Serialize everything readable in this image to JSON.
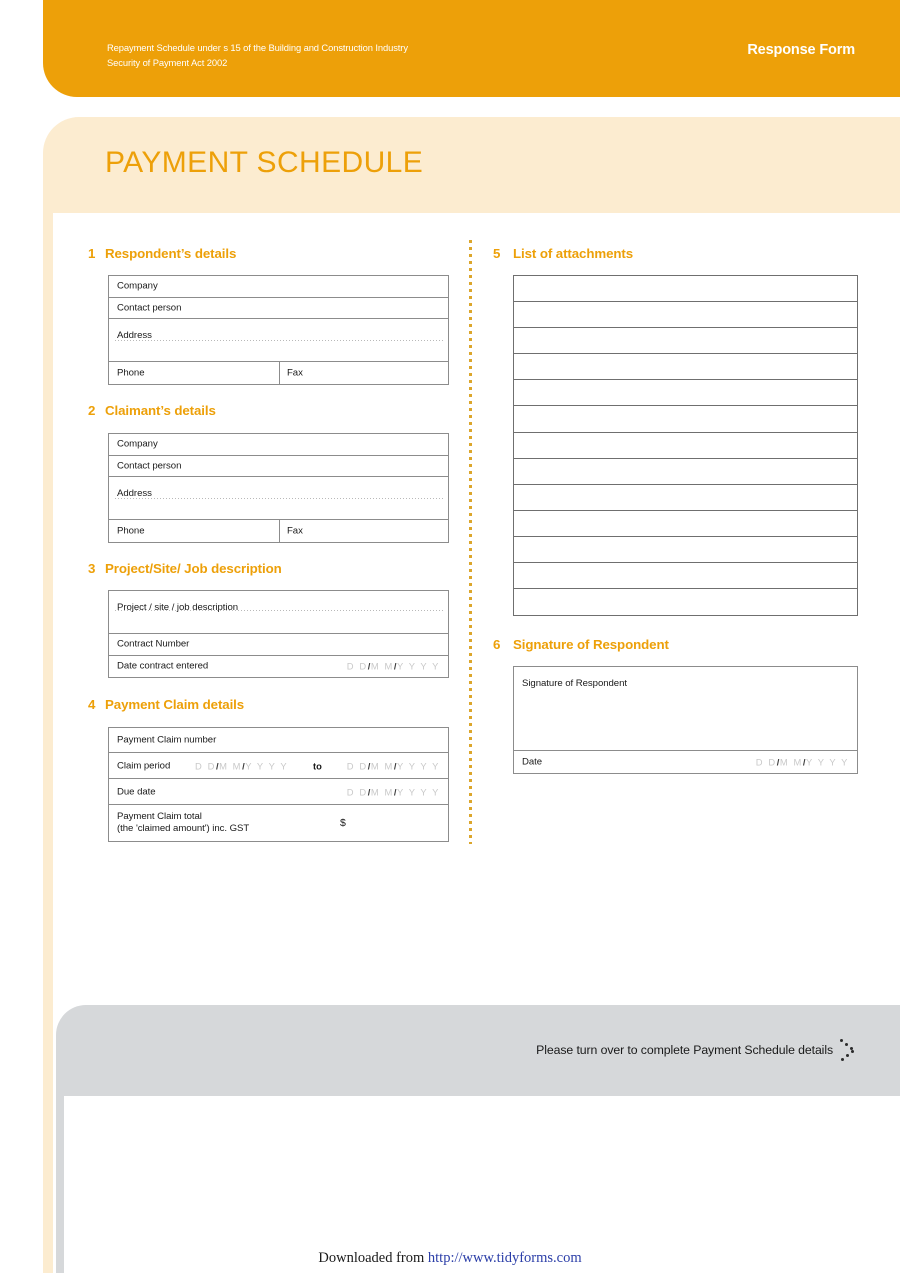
{
  "header": {
    "legal_line1": "Repayment Schedule under s 15 of the Building and Construction Industry",
    "legal_line2": "Security of Payment  Act 2002",
    "form_type": "Response Form",
    "brand_orange": "#eda009",
    "brand_cream": "#fcecd0",
    "brand_grey": "#d6d8da"
  },
  "title": "PAYMENT SCHEDULE",
  "sections": {
    "s1": {
      "number": "1",
      "heading": "Respondent’s details",
      "rows": {
        "company": "Company",
        "contact": "Contact person",
        "address": "Address",
        "phone": "Phone",
        "fax": "Fax"
      }
    },
    "s2": {
      "number": "2",
      "heading": "Claimant’s details",
      "rows": {
        "company": "Company",
        "contact": "Contact person",
        "address": "Address",
        "phone": "Phone",
        "fax": "Fax"
      }
    },
    "s3": {
      "number": "3",
      "heading": "Project/Site/ Job description",
      "rows": {
        "description": "Project / site / job description",
        "contract_number": "Contract Number",
        "date_entered": "Date contract entered"
      }
    },
    "s4": {
      "number": "4",
      "heading": "Payment Claim details",
      "rows": {
        "claim_number": "Payment Claim number",
        "claim_period": "Claim period",
        "to": "to",
        "due_date": "Due date",
        "total_line1": "Payment Claim total",
        "total_line2": "(the 'claimed amount') inc. GST",
        "currency_symbol": "$"
      }
    },
    "s5": {
      "number": "5",
      "heading": "List of attachments",
      "row_count": 13,
      "rows": [
        "",
        "",
        "",
        "",
        "",
        "",
        "",
        "",
        "",
        "",
        "",
        "",
        ""
      ]
    },
    "s6": {
      "number": "6",
      "heading": "Signature of Respondent",
      "rows": {
        "signature": "Signature of Respondent",
        "date": "Date"
      }
    }
  },
  "date_placeholder": {
    "day": "D D",
    "month": "M M",
    "year": "Y Y Y Y",
    "separator": "/"
  },
  "footer": {
    "turn_over_text": "Please turn over to complete Payment Schedule details",
    "chevron_icon": "chevron-right-dots-icon",
    "download_prefix": "Downloaded from ",
    "download_url_text": "http://www.tidyforms.com"
  }
}
